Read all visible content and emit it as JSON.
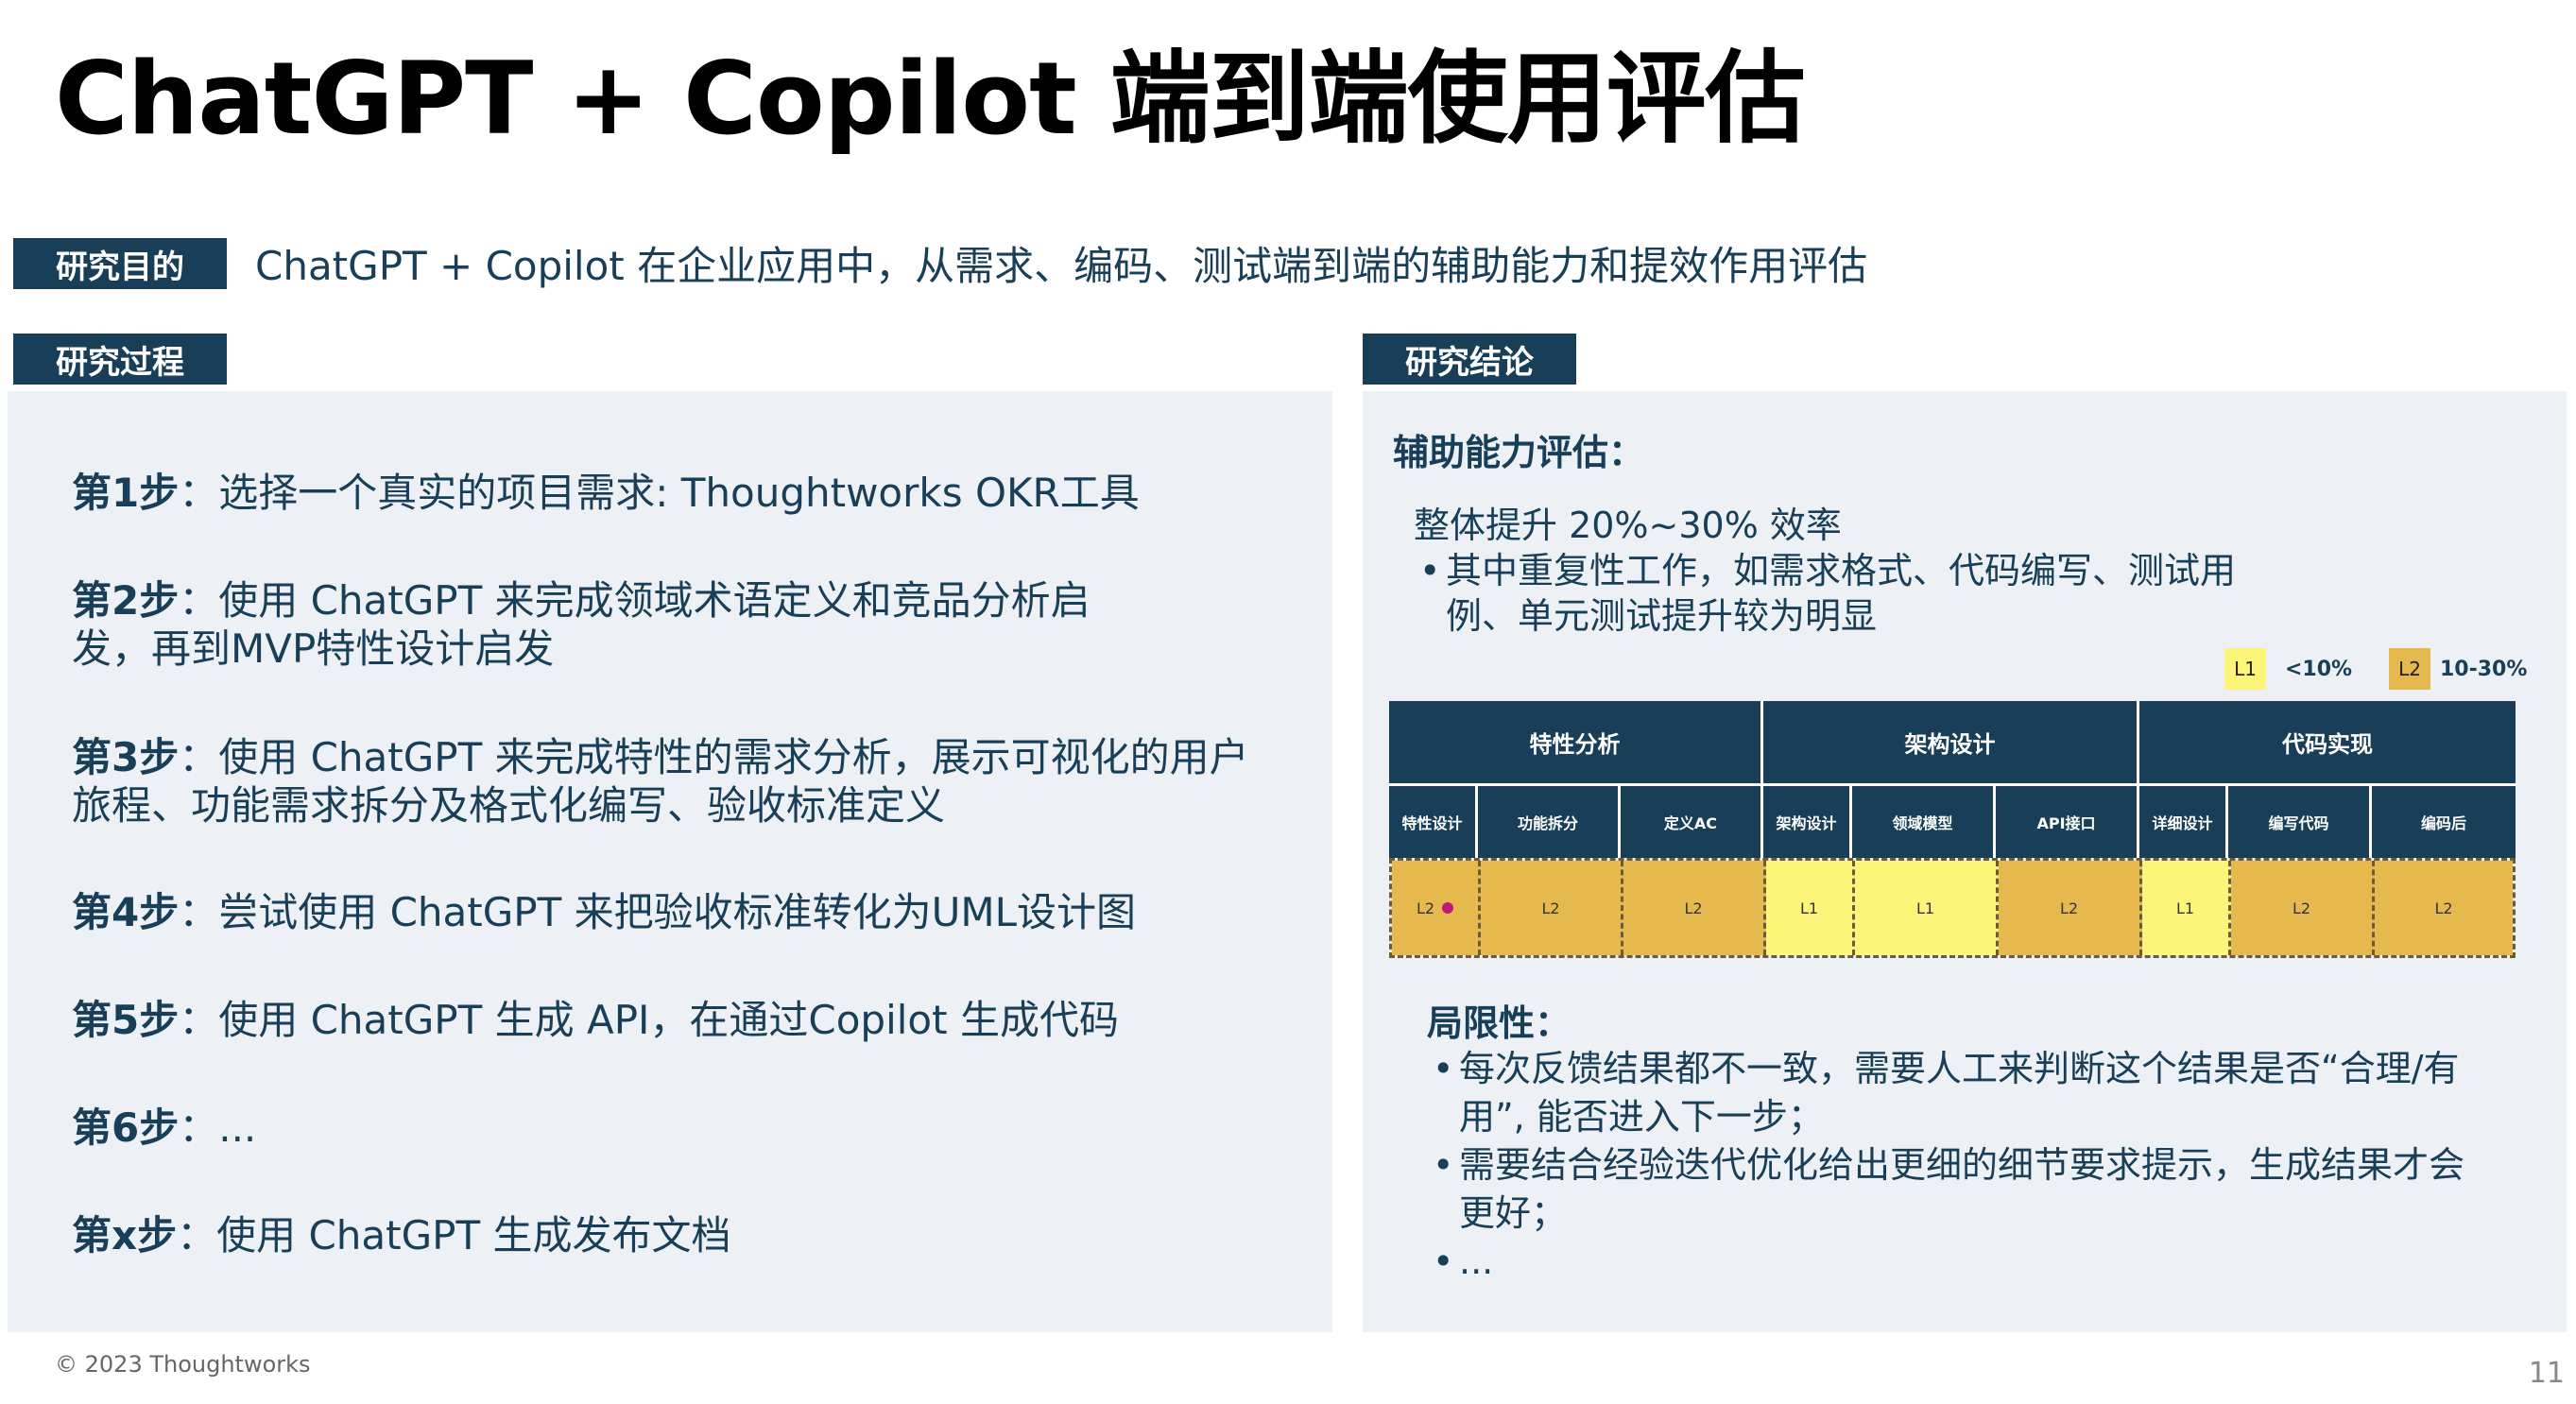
{
  "title": "ChatGPT + Copilot 端到端使用评估",
  "purpose": {
    "label": "研究目的",
    "text": "ChatGPT + Copilot 在企业应用中，从需求、编码、测试端到端的辅助能力和提效作用评估"
  },
  "process": {
    "label": "研究过程",
    "steps": [
      {
        "head": "第1步",
        "text": "：选择一个真实的项目需求: Thoughtworks OKR工具"
      },
      {
        "head": "第2步",
        "text": "：使用 ChatGPT 来完成领域术语定义和竞品分析启发，再到MVP特性设计启发"
      },
      {
        "head": "第3步",
        "text": "：使用 ChatGPT 来完成特性的需求分析，展示可视化的用户旅程、功能需求拆分及格式化编写、验收标准定义"
      },
      {
        "head": "第4步",
        "text": "：尝试使用 ChatGPT 来把验收标准转化为UML设计图"
      },
      {
        "head": "第5步",
        "text": "：使用 ChatGPT 生成 API，在通过Copilot 生成代码"
      },
      {
        "head": "第6步",
        "text": "：..."
      },
      {
        "head": "第x步",
        "text": "：使用 ChatGPT 生成发布文档"
      }
    ]
  },
  "conclusion": {
    "label": "研究结论",
    "assist_heading": "辅助能力评估：",
    "overall": "整体提升 20%~30% 效率",
    "overall_bullets": [
      "其中重复性工作，如需求格式、代码编写、测试用例、单元测试提升较为明显"
    ],
    "legend": [
      {
        "level": "L1",
        "range": "<10%",
        "color": "#fdf57a"
      },
      {
        "level": "L2",
        "range": "10-30%",
        "color": "#e6b94f"
      }
    ],
    "matrix": {
      "groups": [
        {
          "label": "特性分析"
        },
        {
          "label": "架构设计"
        },
        {
          "label": "代码实现"
        }
      ],
      "cells": [
        {
          "label": "特性设计",
          "level": "L2",
          "marker": true
        },
        {
          "label": "功能拆分",
          "level": "L2"
        },
        {
          "label": "定义AC",
          "level": "L2"
        },
        {
          "label": "架构设计",
          "level": "L1"
        },
        {
          "label": "领域模型",
          "level": "L1"
        },
        {
          "label": "API接口",
          "level": "L2"
        },
        {
          "label": "详细设计",
          "level": "L1"
        },
        {
          "label": "编写代码",
          "level": "L2"
        },
        {
          "label": "编码后",
          "level": "L2"
        }
      ]
    },
    "limit_heading": "局限性：",
    "limits": [
      "每次反馈结果都不一致，需要人工来判断这个结果是否“合理/有用”, 能否进入下一步；",
      "需要结合经验迭代优化给出更细的细节要求提示，生成结果才会更好；",
      "..."
    ]
  },
  "footer": "© 2023 Thoughtworks",
  "page_number": "11"
}
